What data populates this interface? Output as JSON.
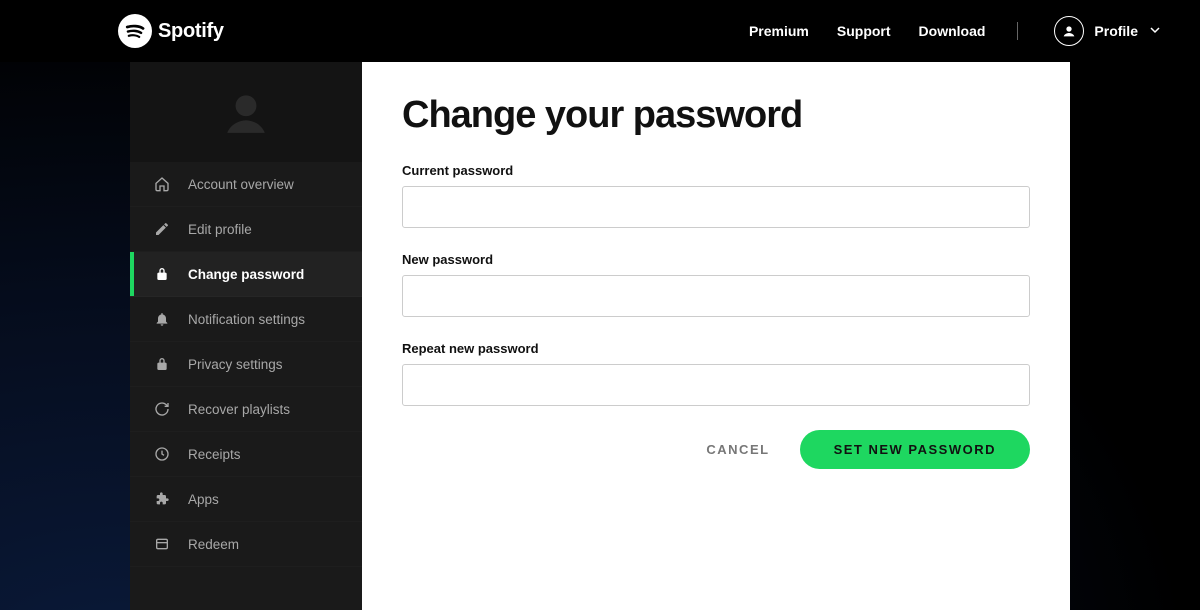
{
  "brand": {
    "name": "Spotify"
  },
  "header": {
    "nav": {
      "premium": "Premium",
      "support": "Support",
      "download": "Download"
    },
    "profile_label": "Profile"
  },
  "sidebar": {
    "items": [
      {
        "key": "overview",
        "label": "Account overview",
        "icon": "home-icon"
      },
      {
        "key": "edit-profile",
        "label": "Edit profile",
        "icon": "pencil-icon"
      },
      {
        "key": "change-password",
        "label": "Change password",
        "icon": "lock-icon",
        "active": true
      },
      {
        "key": "notifications",
        "label": "Notification settings",
        "icon": "bell-icon"
      },
      {
        "key": "privacy",
        "label": "Privacy settings",
        "icon": "lock-icon"
      },
      {
        "key": "recover",
        "label": "Recover playlists",
        "icon": "refresh-icon"
      },
      {
        "key": "receipts",
        "label": "Receipts",
        "icon": "clock-icon"
      },
      {
        "key": "apps",
        "label": "Apps",
        "icon": "puzzle-icon"
      },
      {
        "key": "redeem",
        "label": "Redeem",
        "icon": "card-icon"
      }
    ]
  },
  "main": {
    "title": "Change your password",
    "fields": {
      "current": {
        "label": "Current password",
        "value": ""
      },
      "new": {
        "label": "New password",
        "value": ""
      },
      "repeat": {
        "label": "Repeat new password",
        "value": ""
      }
    },
    "buttons": {
      "cancel": "CANCEL",
      "submit": "SET NEW PASSWORD"
    }
  },
  "colors": {
    "accent": "#1ed760"
  }
}
